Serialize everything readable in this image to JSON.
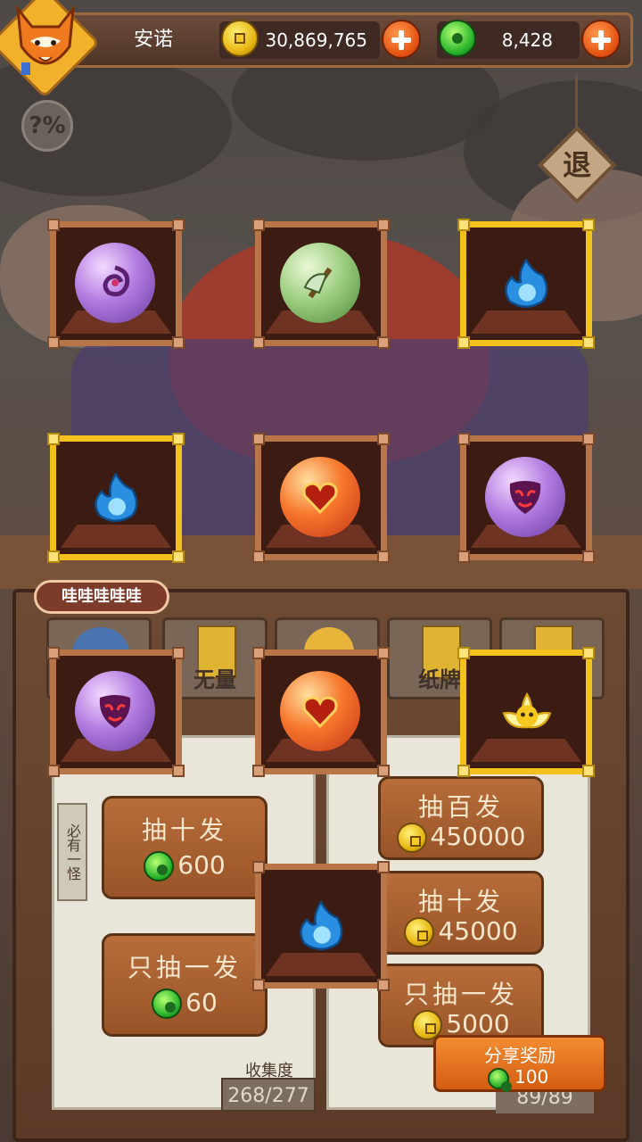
{
  "header": {
    "player_name": "安诺",
    "gold_amount": "30,869,765",
    "jade_amount": "8,428"
  },
  "buttons": {
    "help": "?%",
    "exit": "退"
  },
  "speech_bubble": "哇哇哇哇哇",
  "tabs": [
    {
      "label": ""
    },
    {
      "label": "无量"
    },
    {
      "label": ""
    },
    {
      "label": "纸牌"
    },
    {
      "label": ""
    }
  ],
  "side_banner": "必有一怪",
  "draw_buttons": {
    "jade_ten": {
      "title": "抽十发",
      "price": "600"
    },
    "jade_one": {
      "title": "只抽一发",
      "price": "60"
    },
    "gold_hundred": {
      "title": "抽百发",
      "price": "450000"
    },
    "gold_ten": {
      "title": "抽十发",
      "price": "45000"
    },
    "gold_one": {
      "title": "只抽一发",
      "price": "5000"
    }
  },
  "collection": {
    "label": "收集度",
    "count": "268/277",
    "right_count": "89/89"
  },
  "share": {
    "label": "分享奖励",
    "amount": "100"
  },
  "rewards": [
    {
      "item": "purple-spiral-orb",
      "rarity": "normal"
    },
    {
      "item": "green-axe-orb",
      "rarity": "normal"
    },
    {
      "item": "blue-flame",
      "rarity": "gold"
    },
    {
      "item": "blue-flame",
      "rarity": "gold"
    },
    {
      "item": "fire-heart-orb",
      "rarity": "normal"
    },
    {
      "item": "purple-mask-orb",
      "rarity": "normal"
    },
    {
      "item": "purple-mask-orb",
      "rarity": "normal"
    },
    {
      "item": "fire-heart-orb",
      "rarity": "normal"
    },
    {
      "item": "yellow-lotus",
      "rarity": "gold"
    },
    {
      "item": "blue-flame",
      "rarity": "normal"
    }
  ],
  "colors": {
    "gold_frame": "#f2c11b",
    "wood_frame": "#b77548",
    "accent_orange": "#e24f10"
  }
}
